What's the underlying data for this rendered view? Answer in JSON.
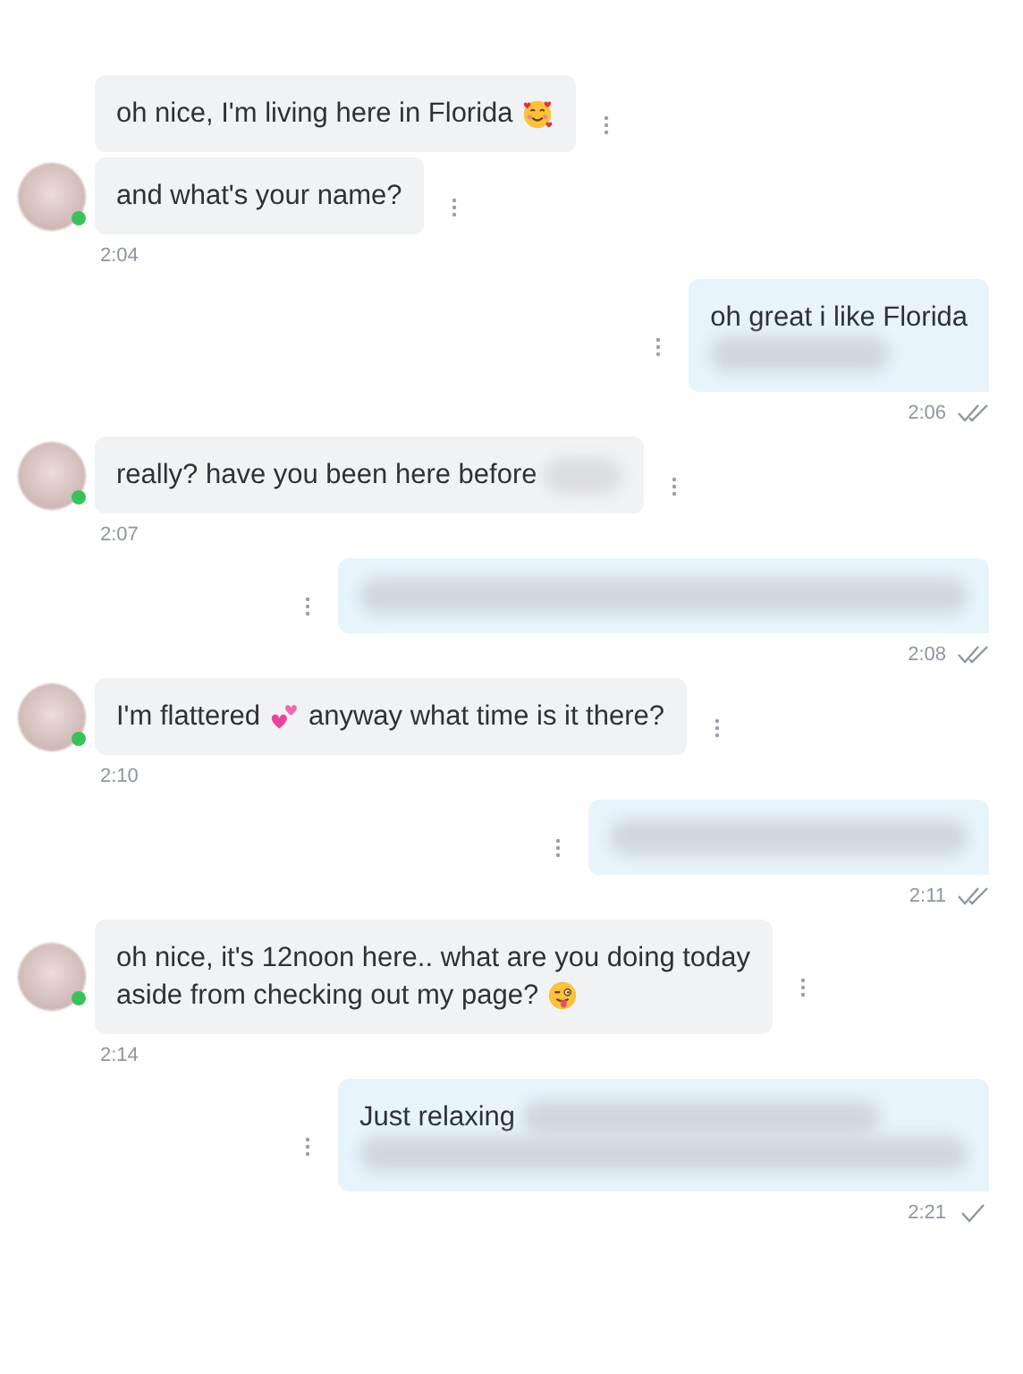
{
  "messages": [
    {
      "kind": "incoming",
      "online": true,
      "time": "2:04",
      "bubbles": [
        {
          "lines": [
            [
              {
                "kind": "text",
                "text": "oh nice, I'm living here in Florida"
              },
              {
                "kind": "blushing"
              }
            ]
          ]
        },
        {
          "lines": [
            [
              {
                "kind": "text",
                "text": "and what's your name?"
              }
            ]
          ]
        }
      ]
    },
    {
      "kind": "outgoing",
      "time": "2:06",
      "read": true,
      "bubbles": [
        {
          "lines": [
            [
              {
                "kind": "text",
                "text": "oh great i like Florida"
              }
            ],
            [
              {
                "kind": "smudge"
              }
            ]
          ]
        }
      ]
    },
    {
      "kind": "incoming",
      "online": true,
      "time": "2:07",
      "bubbles": [
        {
          "lines": [
            [
              {
                "kind": "text",
                "text": "really? have you been here before"
              },
              {
                "kind": "blot"
              }
            ]
          ]
        }
      ]
    },
    {
      "kind": "outgoing",
      "time": "2:08",
      "read": true,
      "bubbles": [
        {
          "lines": [
            [
              {
                "kind": "streak"
              }
            ]
          ]
        }
      ]
    },
    {
      "kind": "incoming",
      "online": true,
      "time": "2:10",
      "bubbles": [
        {
          "lines": [
            [
              {
                "kind": "text",
                "text": "I'm flattered"
              },
              {
                "kind": "hearts"
              },
              {
                "kind": "text",
                "text": "anyway what time is it there?"
              }
            ]
          ]
        }
      ]
    },
    {
      "kind": "outgoing",
      "time": "2:11",
      "read": true,
      "bubbles": [
        {
          "lines": [
            [
              {
                "kind": "smear"
              }
            ]
          ]
        }
      ]
    },
    {
      "kind": "incoming",
      "online": true,
      "time": "2:14",
      "bubbles": [
        {
          "lines": [
            [
              {
                "kind": "text",
                "text": "oh nice, it's 12noon here.. what are you doing today"
              }
            ],
            [
              {
                "kind": "text",
                "text": "aside from checking out my page?"
              },
              {
                "kind": "winking"
              }
            ]
          ]
        }
      ]
    },
    {
      "kind": "outgoing",
      "time": "2:21",
      "read": false,
      "bubbles": [
        {
          "lines": [
            [
              {
                "kind": "text",
                "text": "Just relaxing"
              },
              {
                "kind": "smear"
              }
            ],
            [
              {
                "kind": "streak"
              }
            ]
          ]
        }
      ]
    }
  ]
}
